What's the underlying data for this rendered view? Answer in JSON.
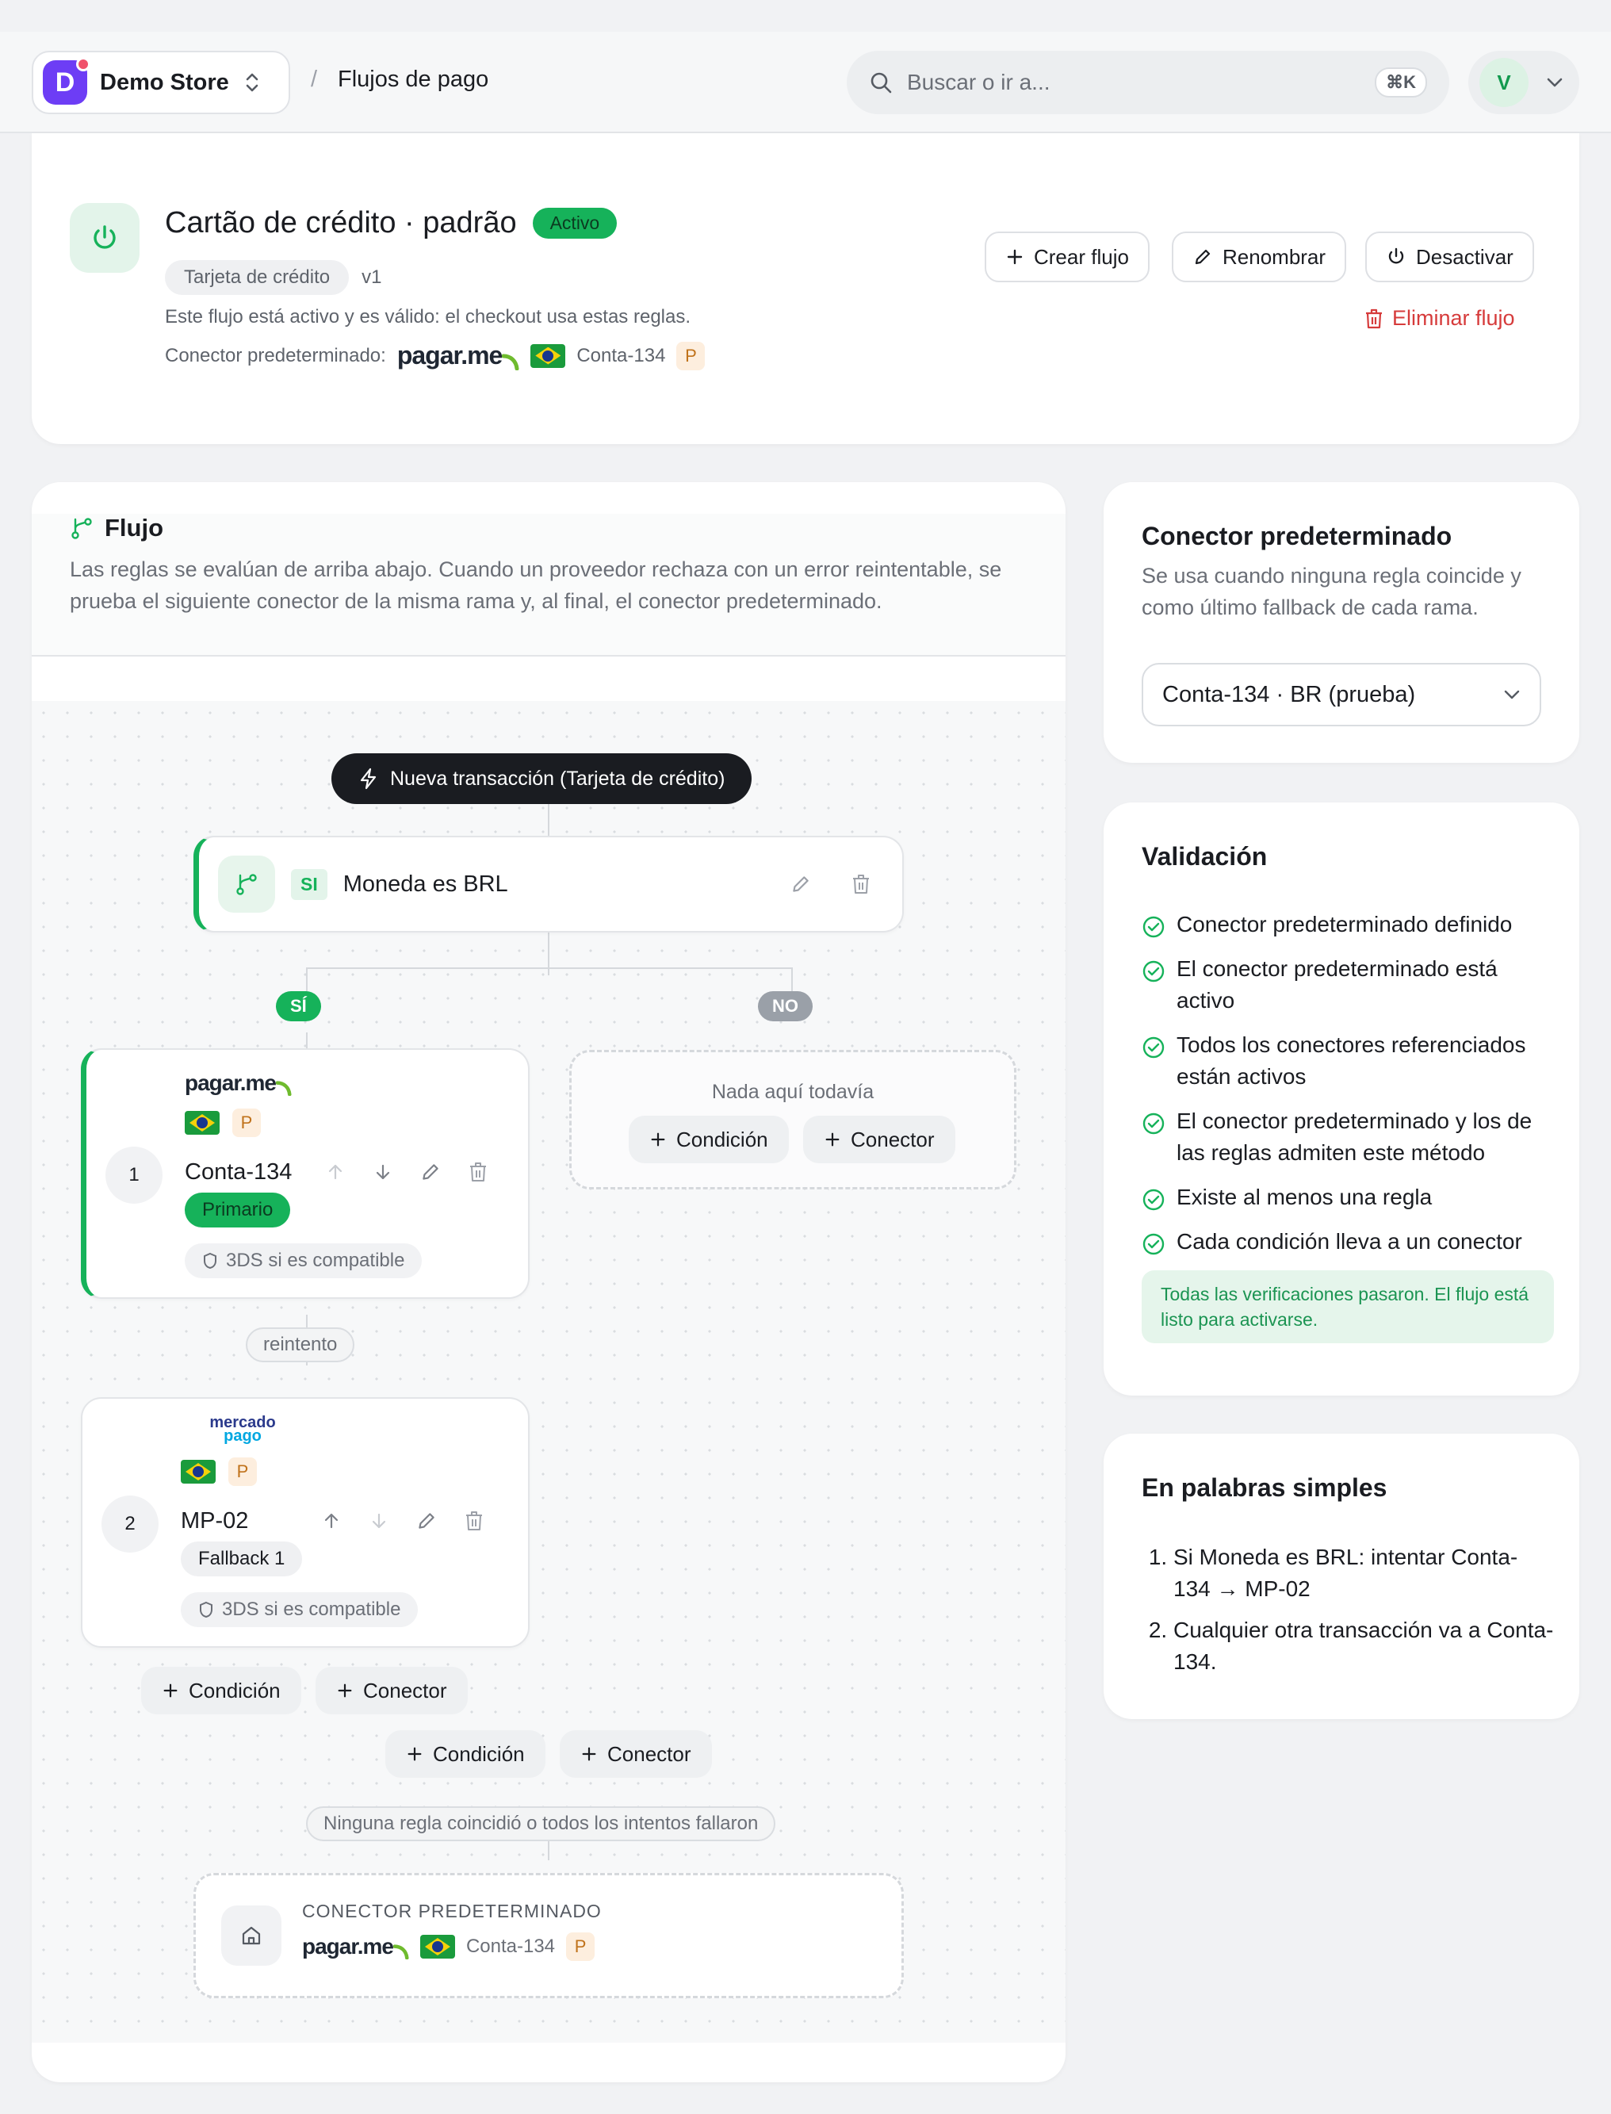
{
  "topbar": {
    "store_initial": "D",
    "store_name": "Demo Store",
    "breadcrumb_sep": "/",
    "breadcrumb_current": "Flujos de pago",
    "search_placeholder": "Buscar o ir a...",
    "search_shortcut": "⌘K",
    "user_initial": "V"
  },
  "header": {
    "title": "Cartão de crédito · padrão",
    "status": "Activo",
    "method": "Tarjeta de crédito",
    "version": "v1",
    "description": "Este flujo está activo y es válido: el checkout usa estas reglas.",
    "connector_label": "Conector predeterminado:",
    "connector_provider": "pagar.me",
    "connector_account": "Conta-134",
    "connector_env": "P",
    "actions": {
      "create": "Crear flujo",
      "rename": "Renombrar",
      "deactivate": "Desactivar",
      "delete": "Eliminar flujo"
    }
  },
  "flow": {
    "title": "Flujo",
    "description": "Las reglas se evalúan de arriba abajo. Cuando un proveedor rechaza con un error reintentable, se prueba el siguiente conector de la misma rama y, al final, el conector predeterminado.",
    "trigger": "Nueva transacción (Tarjeta de crédito)",
    "condition": {
      "prefix": "SI",
      "text": "Moneda es BRL"
    },
    "branch_yes": "SÍ",
    "branch_no": "NO",
    "empty_text": "Nada aquí todavía",
    "add_condition": "Condición",
    "add_connector": "Conector",
    "retry_label": "reintento",
    "connectors": [
      {
        "index": "1",
        "provider": "pagar.me",
        "env": "P",
        "name": "Conta-134",
        "role": "Primario",
        "threeds": "3DS si es compatible"
      },
      {
        "index": "2",
        "provider": "mercado pago",
        "provider_line1": "mercado",
        "provider_line2": "pago",
        "env": "P",
        "name": "MP-02",
        "role": "Fallback 1",
        "threeds": "3DS si es compatible"
      }
    ],
    "fallthrough_label": "Ninguna regla coincidió o todos los intentos fallaron",
    "default": {
      "label": "CONECTOR PREDETERMINADO",
      "provider": "pagar.me",
      "account": "Conta-134",
      "env": "P"
    }
  },
  "default_connector": {
    "title": "Conector predeterminado",
    "description": "Se usa cuando ninguna regla coincide y como último fallback de cada rama.",
    "selected": "Conta-134 · BR (prueba)"
  },
  "validation": {
    "title": "Validación",
    "checks": [
      "Conector predeterminado definido",
      "El conector predeterminado está activo",
      "Todos los conectores referenciados están activos",
      "El conector predeterminado y los de las reglas admiten este método",
      "Existe al menos una regla",
      "Cada condición lleva a un conector"
    ],
    "summary": "Todas las verificaciones pasaron. El flujo está listo para activarse."
  },
  "simple": {
    "title": "En palabras simples",
    "items": [
      "Si Moneda es BRL: intentar Conta-134 → MP-02",
      "Cualquier otra transacción va a Conta-134."
    ]
  },
  "colors": {
    "accent": "#16b25a",
    "brand": "#6d3df5",
    "danger": "#d63b3b"
  }
}
